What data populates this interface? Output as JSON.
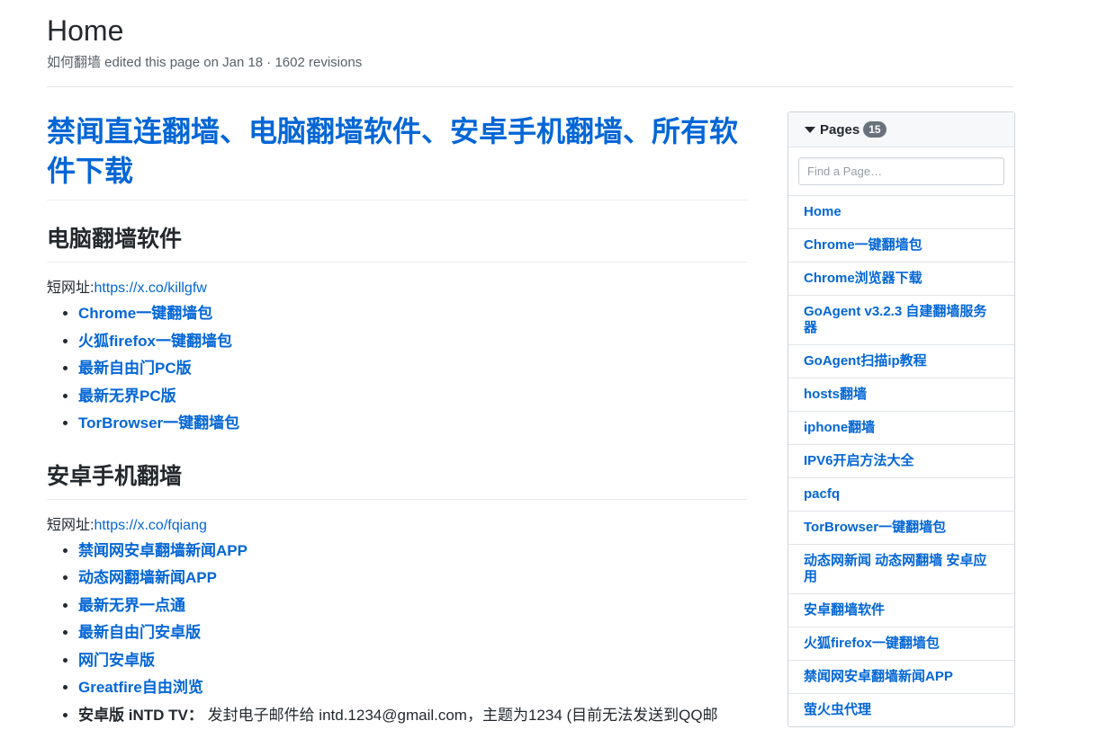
{
  "header": {
    "title": "Home",
    "meta": "如何翻墙 edited this page on Jan 18 · 1602 revisions"
  },
  "main": {
    "heading": "禁闻直连翻墙、电脑翻墙软件、安卓手机翻墙、所有软件下载",
    "sections": [
      {
        "title": "电脑翻墙软件",
        "shorturl_label": "短网址:",
        "shorturl": "https://x.co/killgfw",
        "items": [
          "Chrome一键翻墙包",
          "火狐firefox一键翻墙包",
          "最新自由门PC版",
          "最新无界PC版",
          "TorBrowser一键翻墙包"
        ]
      },
      {
        "title": "安卓手机翻墙",
        "shorturl_label": "短网址:",
        "shorturl": "https://x.co/fqiang",
        "items": [
          "禁闻网安卓翻墙新闻APP",
          "动态网翻墙新闻APP",
          "最新无界一点通",
          "最新自由门安卓版",
          "网门安卓版",
          "Greatfire自由浏览"
        ],
        "extra_item": {
          "label": "安卓版 iNTD TV：",
          "text": " 发封电子邮件给 intd.1234@gmail.com，主题为1234 (目前无法发送到QQ邮"
        }
      }
    ]
  },
  "sidebar": {
    "title": "Pages",
    "count": "15",
    "search_placeholder": "Find a Page…",
    "pages": [
      "Home",
      "Chrome一键翻墙包",
      "Chrome浏览器下载",
      "GoAgent v3.2.3 自建翻墙服务器",
      "GoAgent扫描ip教程",
      "hosts翻墙",
      "iphone翻墙",
      "IPV6开启方法大全",
      "pacfq",
      "TorBrowser一键翻墙包",
      "动态网新闻 动态网翻墙 安卓应用",
      "安卓翻墙软件",
      "火狐firefox一键翻墙包",
      "禁闻网安卓翻墙新闻APP",
      "萤火虫代理"
    ]
  }
}
